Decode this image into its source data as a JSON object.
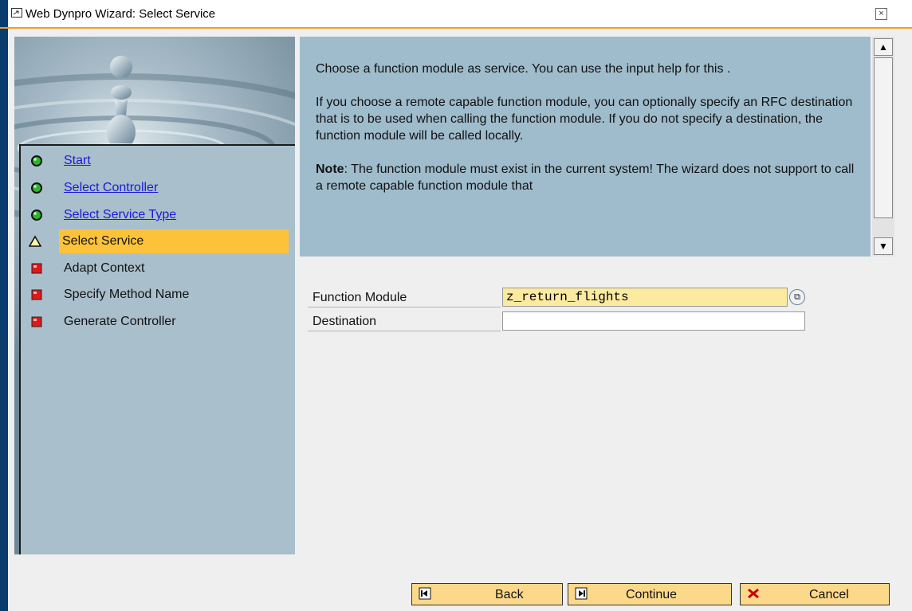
{
  "window": {
    "title": "Web Dynpro Wizard: Select Service",
    "close_label": "×"
  },
  "steps": [
    {
      "label": "Start",
      "status": "done",
      "icon": "green-light-icon",
      "link": true
    },
    {
      "label": "Select Controller",
      "status": "done",
      "icon": "green-light-icon",
      "link": true
    },
    {
      "label": "Select Service Type",
      "status": "done",
      "icon": "green-light-icon",
      "link": true
    },
    {
      "label": "Select Service",
      "status": "current",
      "icon": "warning-triangle-icon",
      "link": false
    },
    {
      "label": "Adapt Context",
      "status": "pending",
      "icon": "red-square-icon",
      "link": false
    },
    {
      "label": "Specify Method Name",
      "status": "pending",
      "icon": "red-square-icon",
      "link": false
    },
    {
      "label": "Generate Controller",
      "status": "pending",
      "icon": "red-square-icon",
      "link": false
    }
  ],
  "info": {
    "para1": "Choose a function module as service. You can use the input help for this .",
    "para2": "If you choose a remote capable function module, you can optionally specify an RFC destination that is to be used when calling the function module. If you do not specify a destination, the function module will be called locally.",
    "note_label": "Note",
    "note_text": ": The function module must exist in the current system! The wizard does not support to call a remote capable function module that"
  },
  "form": {
    "function_module_label": "Function Module",
    "function_module_value": "z_return_flights",
    "destination_label": "Destination",
    "destination_value": ""
  },
  "buttons": {
    "back": "Back",
    "continue": "Continue",
    "cancel": "Cancel"
  },
  "colors": {
    "active_step": "#fcc33a",
    "required_field": "#fbeaa0",
    "info_panel": "#9fbccc",
    "title_accent": "#f0a020"
  }
}
